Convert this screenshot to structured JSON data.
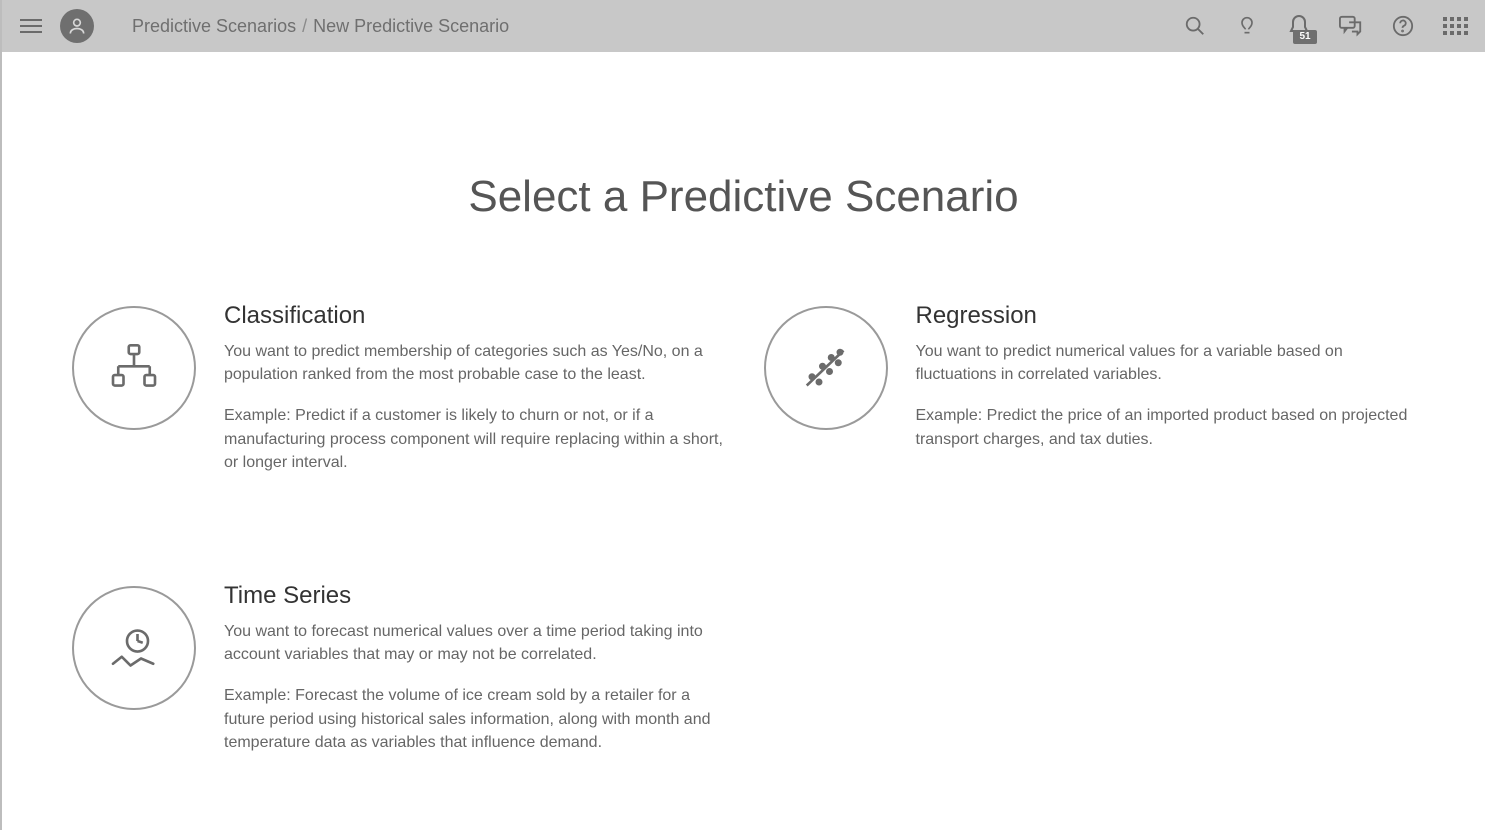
{
  "breadcrumb": {
    "root": "Predictive Scenarios",
    "current": "New Predictive Scenario"
  },
  "header": {
    "notification_count": "51"
  },
  "page": {
    "title": "Select a Predictive Scenario"
  },
  "scenarios": {
    "classification": {
      "title": "Classification",
      "desc": "You want to predict membership of categories such as Yes/No, on a population ranked from the most probable case to the least.",
      "example": "Example: Predict if a customer is likely to churn or not, or if a manufacturing process component will require replacing within a short, or longer interval."
    },
    "regression": {
      "title": "Regression",
      "desc": "You want to predict numerical values for a variable based on fluctuations in correlated variables.",
      "example": "Example: Predict the price of an imported product based on projected transport charges, and tax duties."
    },
    "timeseries": {
      "title": "Time Series",
      "desc": "You want to forecast numerical values over a time period taking into account variables that may or may not be correlated.",
      "example": "Example: Forecast the volume of ice cream sold by a retailer for a future period using historical sales information, along with month and temperature data as variables that influence demand."
    }
  }
}
